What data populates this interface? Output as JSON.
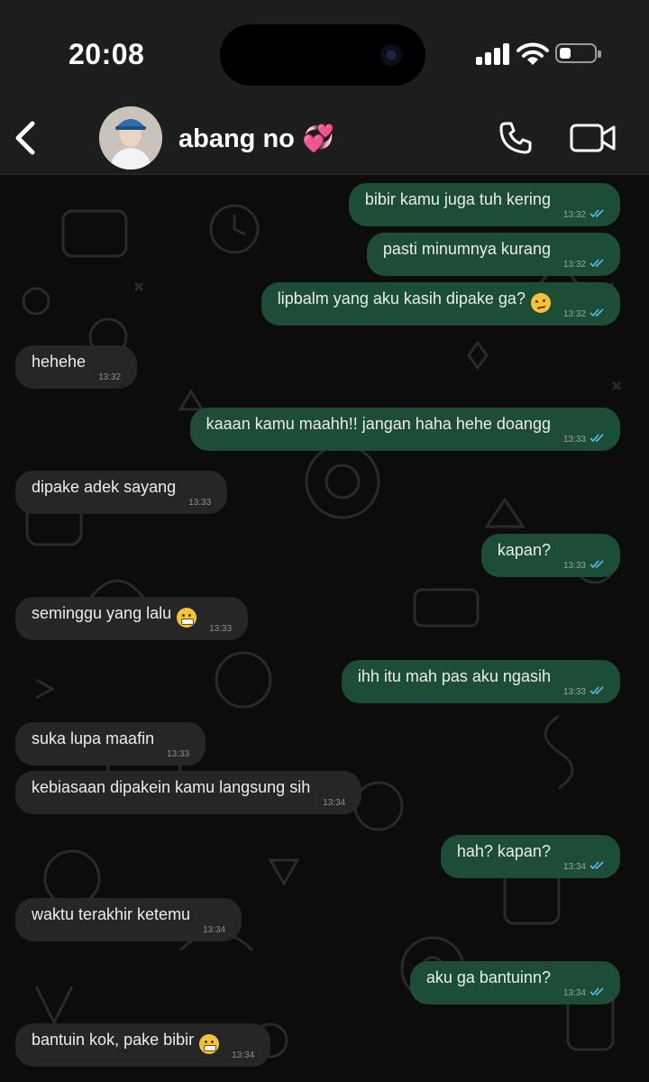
{
  "status_bar": {
    "time": "20:08"
  },
  "header": {
    "contact_name": "abang no 💞"
  },
  "colors": {
    "outgoing": "#1d4c37",
    "incoming": "#262626",
    "tick": "#53bdeb"
  },
  "messages": [
    {
      "dir": "out",
      "text": "bibir kamu juga tuh kering",
      "time": "13:32"
    },
    {
      "dir": "out",
      "text": "pasti minumnya kurang",
      "time": "13:32"
    },
    {
      "dir": "out",
      "text": "lipbalm yang aku kasih dipake ga?",
      "emoji": "raised-eyebrow-emoji",
      "time": "13:32"
    },
    {
      "dir": "in",
      "text": "hehehe",
      "time": "13:32"
    },
    {
      "dir": "out",
      "text": "kaaan kamu maahh!! jangan haha hehe doangg",
      "time": "13:33"
    },
    {
      "dir": "in",
      "text": "dipake adek sayang",
      "time": "13:33"
    },
    {
      "dir": "out",
      "text": "kapan?",
      "time": "13:33"
    },
    {
      "dir": "in",
      "text": "seminggu yang lalu",
      "emoji": "grimacing-emoji",
      "time": "13:33"
    },
    {
      "dir": "out",
      "text": "ihh itu mah pas aku ngasih",
      "time": "13:33"
    },
    {
      "dir": "in",
      "text": "suka lupa maafin",
      "time": "13:33"
    },
    {
      "dir": "in",
      "text": "kebiasaan dipakein kamu langsung sih",
      "time": "13:34"
    },
    {
      "dir": "out",
      "text": "hah? kapan?",
      "time": "13:34"
    },
    {
      "dir": "in",
      "text": "waktu terakhir ketemu",
      "time": "13:34"
    },
    {
      "dir": "out",
      "text": "aku ga bantuinn?",
      "time": "13:34"
    },
    {
      "dir": "in",
      "text": "bantuin kok, pake bibir",
      "emoji": "grimacing-emoji",
      "time": "13:34"
    }
  ]
}
